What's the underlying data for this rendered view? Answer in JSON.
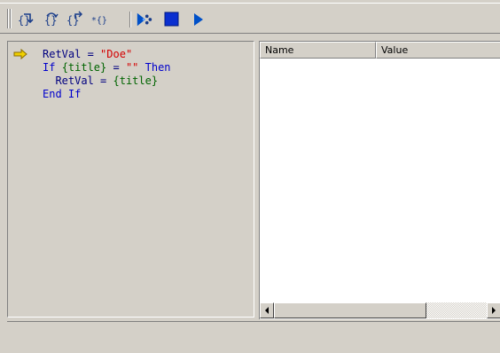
{
  "toolbar": {
    "buttons": [
      {
        "name": "step-into-button",
        "icon": "step-into-icon"
      },
      {
        "name": "step-over-button",
        "icon": "step-over-icon"
      },
      {
        "name": "step-out-button",
        "icon": "step-out-icon"
      },
      {
        "name": "run-to-cursor-button",
        "icon": "run-to-cursor-icon"
      },
      {
        "name": "debug-animate-button",
        "icon": "animate-icon"
      },
      {
        "name": "stop-button",
        "icon": "stop-icon"
      },
      {
        "name": "run-button",
        "icon": "play-icon"
      }
    ],
    "glyph_step_into": "{}",
    "glyph_step_over": "{}",
    "glyph_step_out": "{}",
    "glyph_run_cursor": "*{}"
  },
  "code": {
    "current_line_marker": "current-line-arrow-icon",
    "lines": [
      {
        "t1": "RetVal",
        "t2": " = ",
        "t3": "\"Doe\""
      },
      {
        "kw1": "If ",
        "f1": "{title}",
        "t2": " = ",
        "t3": "\"\"",
        "kw2": " Then"
      },
      {
        "indent": "  ",
        "t1": "RetVal",
        "t2": " = ",
        "f1": "{title}"
      },
      {
        "kw1": "End If"
      }
    ]
  },
  "variables": {
    "columns": [
      "Name",
      "Value"
    ],
    "rows": []
  },
  "colors": {
    "background": "#d4d0c8",
    "keyword": "#0000cc",
    "string": "#d40000",
    "field": "#006400",
    "toolbar_icon": "#0050c8"
  }
}
